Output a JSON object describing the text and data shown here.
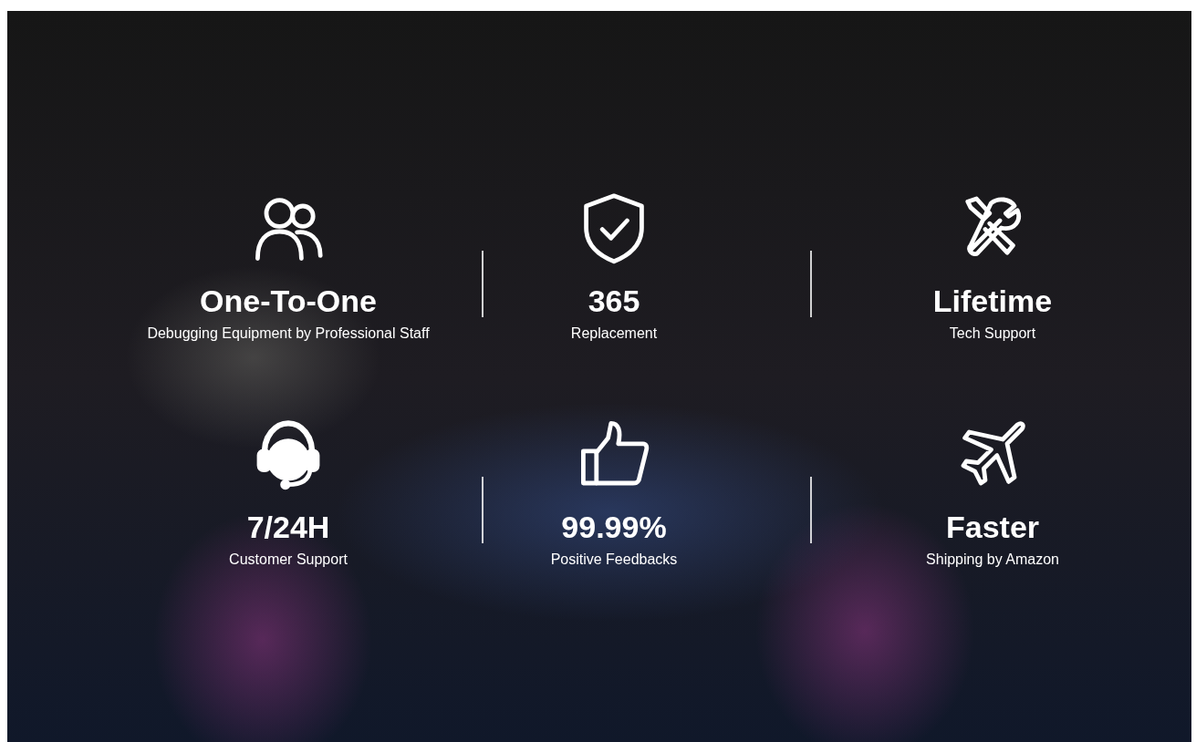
{
  "features": [
    {
      "kind": "people",
      "title": "One-To-One",
      "subtitle": "Debugging Equipment by Professional Staff"
    },
    {
      "kind": "shield",
      "title": "365",
      "subtitle": "Replacement"
    },
    {
      "kind": "tools",
      "title": "Lifetime",
      "subtitle": "Tech Support"
    },
    {
      "kind": "headset",
      "title": "7/24H",
      "subtitle": "Customer Support"
    },
    {
      "kind": "thumb",
      "title": "99.99%",
      "subtitle": "Positive Feedbacks"
    },
    {
      "kind": "plane",
      "title": "Faster",
      "subtitle": "Shipping by Amazon"
    }
  ]
}
